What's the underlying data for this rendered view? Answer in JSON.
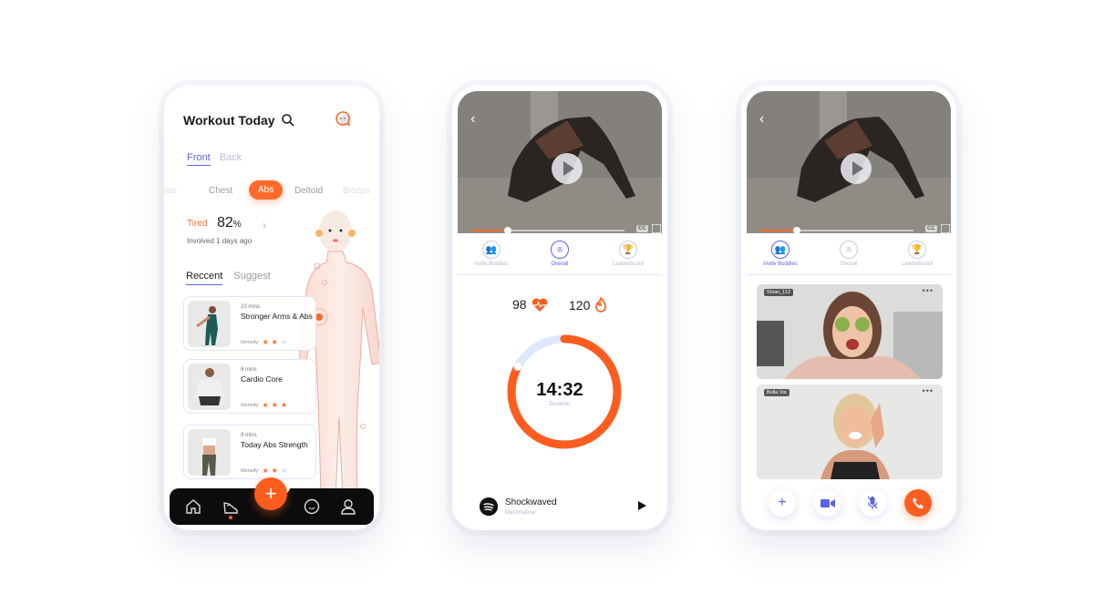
{
  "colors": {
    "accent": "#ff6a2b",
    "primary": "#5a63e6",
    "muted": "#b5b9d0"
  },
  "workout": {
    "title": "Workout Today",
    "icons": {
      "search": "search-icon",
      "chat": "chat-icon"
    },
    "view_tabs": [
      {
        "label": "Front",
        "active": true
      },
      {
        "label": "Back",
        "active": false
      }
    ],
    "muscles": [
      {
        "label": "zius"
      },
      {
        "label": "Chest"
      },
      {
        "label": "Abs",
        "active": true
      },
      {
        "label": "Deltoid"
      },
      {
        "label": "Biceps"
      }
    ],
    "status": {
      "label": "Tired",
      "value": "82",
      "unit": "%",
      "involved": "Involved 1 days ago"
    },
    "list_tabs": [
      {
        "label": "Reccent",
        "active": true
      },
      {
        "label": "Suggest",
        "active": false
      }
    ],
    "cards": [
      {
        "duration": "10 mins",
        "title": "Stronger Arms & Abs",
        "intensity_label": "Idensity:",
        "stars": 2,
        "max_stars": 3
      },
      {
        "duration": "8 mins",
        "title": "Cardio Core",
        "intensity_label": "Idensity:",
        "stars": 3,
        "max_stars": 3
      },
      {
        "duration": "8 mins",
        "title": "Today Abs Strength",
        "intensity_label": "Idensity:",
        "stars": 2,
        "max_stars": 3
      }
    ],
    "nav": [
      {
        "icon": "home-icon"
      },
      {
        "icon": "sneaker-icon",
        "active": true
      },
      {
        "icon": "add-icon",
        "label": "+"
      },
      {
        "icon": "smile-icon"
      },
      {
        "icon": "profile-icon"
      }
    ]
  },
  "video": {
    "back": "‹",
    "progress": 0.24,
    "cc": "CC",
    "tabs": [
      {
        "label": "Invite Buddies",
        "icon": "buddies-icon"
      },
      {
        "label": "Overall",
        "icon": "list-icon"
      },
      {
        "label": "Leaderboard",
        "icon": "trophy-icon"
      }
    ]
  },
  "overall": {
    "active_tab": 1,
    "heart_rate": "98",
    "calories": "120",
    "duration": "14:32",
    "duration_label": "Duration",
    "ring_progress": 0.83,
    "music": {
      "title": "Shockwaved",
      "artist": "Mashmallow"
    }
  },
  "buddies": {
    "active_tab": 0,
    "participants": [
      {
        "name": "Shian_112",
        "more": "•••"
      },
      {
        "name": "Bella Via",
        "more": "•••"
      }
    ],
    "controls": [
      {
        "icon": "add-icon",
        "glyph": "+"
      },
      {
        "icon": "video-icon",
        "glyph": "■"
      },
      {
        "icon": "mic-off-icon",
        "glyph": "🎙"
      },
      {
        "icon": "end-call-icon",
        "glyph": "✆"
      }
    ]
  }
}
